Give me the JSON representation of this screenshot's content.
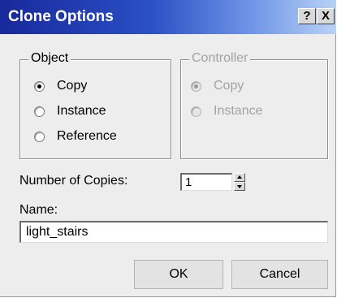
{
  "window": {
    "title": "Clone Options",
    "help_button": "?",
    "close_button": "X"
  },
  "object_group": {
    "legend": "Object",
    "options": [
      {
        "label": "Copy",
        "selected": true
      },
      {
        "label": "Instance",
        "selected": false
      },
      {
        "label": "Reference",
        "selected": false
      }
    ]
  },
  "controller_group": {
    "legend": "Controller",
    "enabled": false,
    "options": [
      {
        "label": "Copy",
        "selected": true
      },
      {
        "label": "Instance",
        "selected": false
      }
    ]
  },
  "copies": {
    "label": "Number of Copies:",
    "value": "1"
  },
  "name": {
    "label": "Name:",
    "value": "light_stairs"
  },
  "buttons": {
    "ok": "OK",
    "cancel": "Cancel"
  },
  "colors": {
    "title_bar_start": "#17299b",
    "title_bar_end": "#b8d2f5",
    "dialog_background": "#ededed",
    "disabled_text": "#a3a3a3"
  }
}
